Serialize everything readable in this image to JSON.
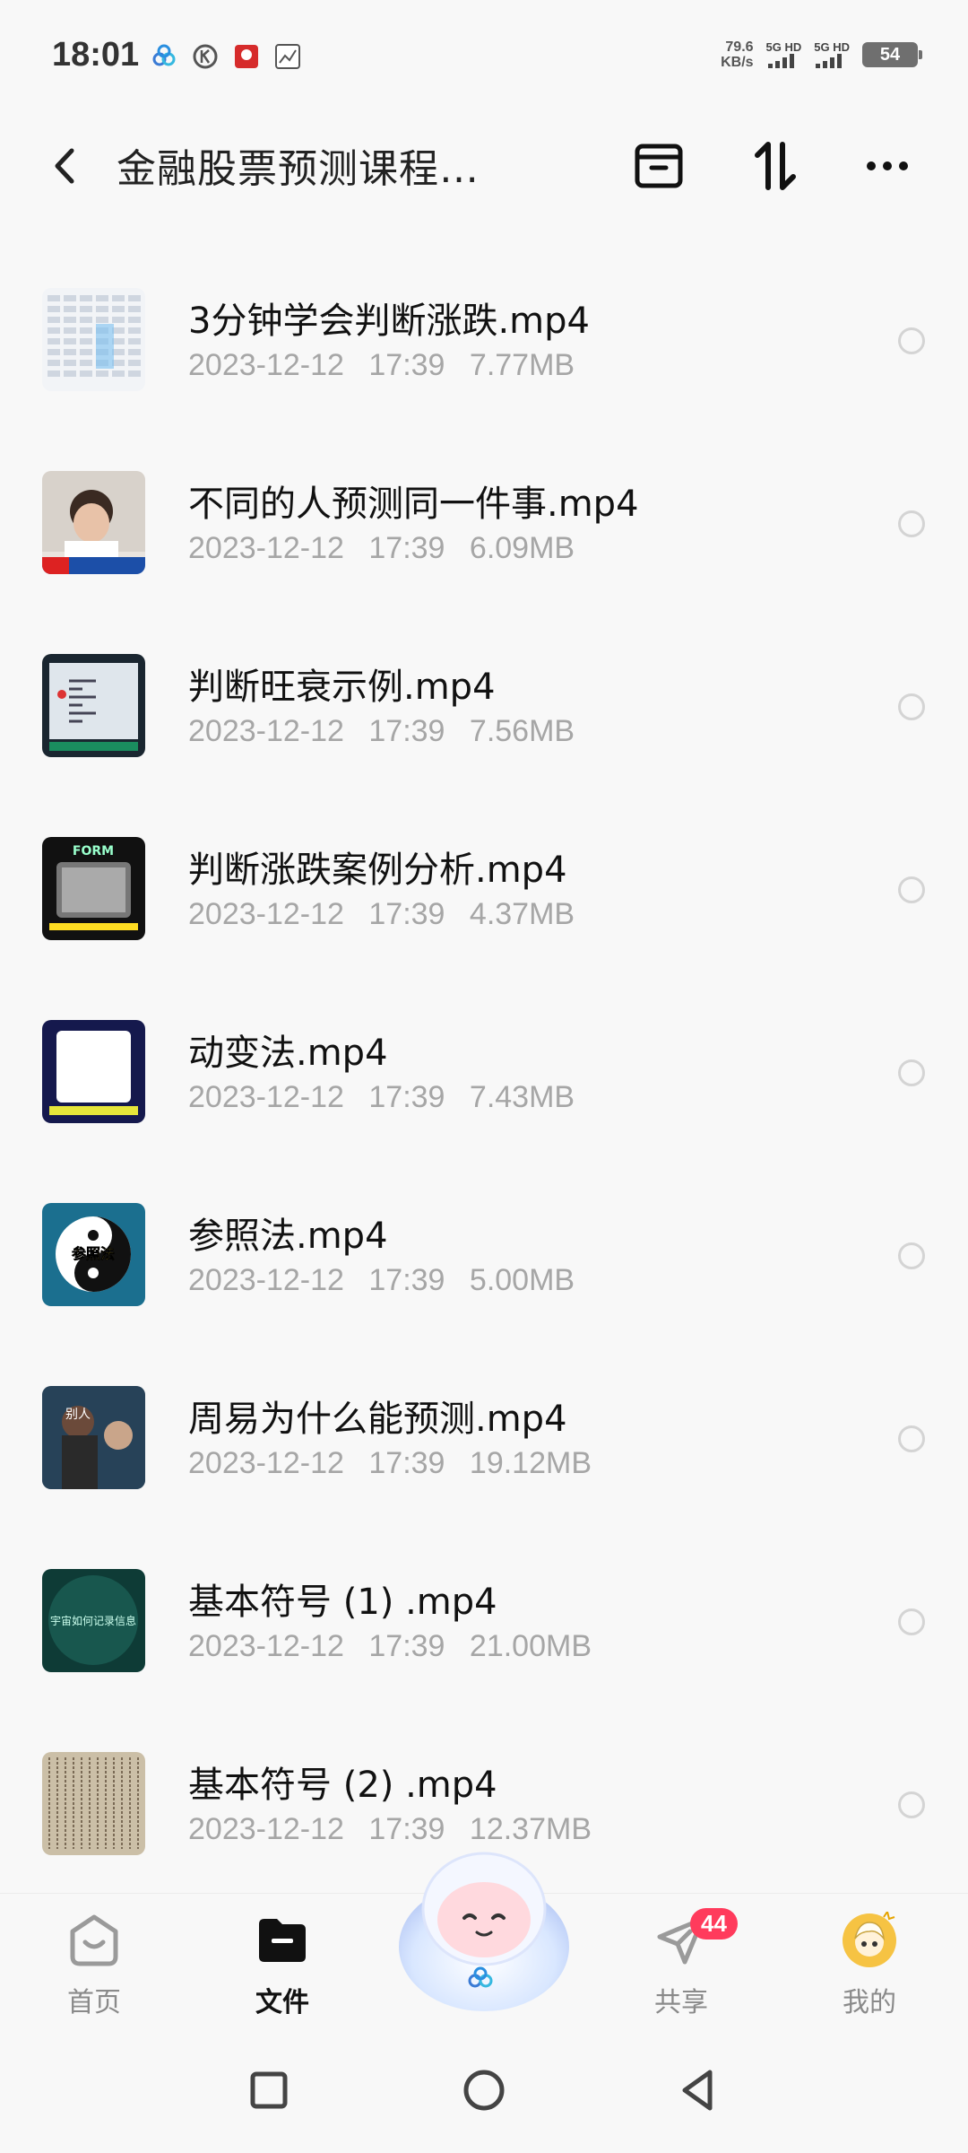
{
  "status_bar": {
    "time": "18:01",
    "net_speed_value": "79.6",
    "net_speed_unit": "KB/s",
    "signal_1": "5G HD",
    "signal_2": "5G HD",
    "battery": "54",
    "icons": [
      "baidu-netdisk-icon",
      "k-circle-icon",
      "app-red-icon",
      "wenxue-app-icon"
    ]
  },
  "header": {
    "title": "金融股票预测课程…",
    "actions": [
      "archive-icon",
      "sort-icon",
      "more-icon"
    ]
  },
  "files": [
    {
      "name": "3分钟学会判断涨跌.mp4",
      "date": "2023-12-12",
      "time": "17:39",
      "size": "7.77MB",
      "thumb": "table-thumbnail"
    },
    {
      "name": "不同的人预测同一件事.mp4",
      "date": "2023-12-12",
      "time": "17:39",
      "size": "6.09MB",
      "thumb": "person-thumbnail"
    },
    {
      "name": "判断旺衰示例.mp4",
      "date": "2023-12-12",
      "time": "17:39",
      "size": "7.56MB",
      "thumb": "chart-thumbnail"
    },
    {
      "name": "判断涨跌案例分析.mp4",
      "date": "2023-12-12",
      "time": "17:39",
      "size": "4.37MB",
      "thumb": "tv-thumbnail"
    },
    {
      "name": "动变法.mp4",
      "date": "2023-12-12",
      "time": "17:39",
      "size": "7.43MB",
      "thumb": "frame-thumbnail"
    },
    {
      "name": "参照法.mp4",
      "date": "2023-12-12",
      "time": "17:39",
      "size": "5.00MB",
      "thumb": "yinyang-thumbnail"
    },
    {
      "name": "周易为什么能预测.mp4",
      "date": "2023-12-12",
      "time": "17:39",
      "size": "19.12MB",
      "thumb": "movie-thumbnail"
    },
    {
      "name": "基本符号 (1) .mp4",
      "date": "2023-12-12",
      "time": "17:39",
      "size": "21.00MB",
      "thumb": "green-thumbnail"
    },
    {
      "name": "基本符号 (2) .mp4",
      "date": "2023-12-12",
      "time": "17:39",
      "size": "12.37MB",
      "thumb": "text-thumbnail"
    }
  ],
  "thumb_text": {
    "yinyang": "参照法",
    "green": "宇宙如何记录信息",
    "movie": "别人",
    "tv": "FORM THE DAY"
  },
  "bottom_nav": [
    {
      "label": "首页",
      "icon": "home-icon",
      "active": false
    },
    {
      "label": "文件",
      "icon": "folder-icon",
      "active": true
    },
    {
      "label": "共享",
      "icon": "paper-plane-icon",
      "active": false,
      "badge": "44"
    },
    {
      "label": "我的",
      "icon": "avatar-icon",
      "active": false
    }
  ],
  "colors": {
    "accent": "#ff3b5c",
    "text_primary": "#111111",
    "text_secondary": "#a6a6a6",
    "background": "#f8f8f8"
  }
}
